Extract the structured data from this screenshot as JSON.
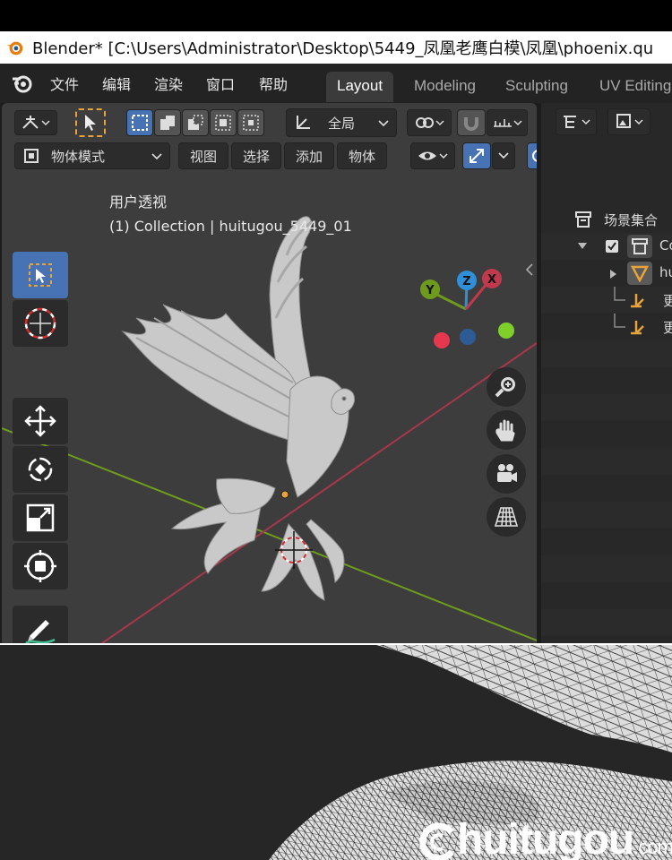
{
  "window": {
    "title": "Blender* [C:\\Users\\Administrator\\Desktop\\5449_凤凰老鹰白模\\凤凰\\phoenix.qu"
  },
  "menubar": {
    "items": [
      "文件",
      "编辑",
      "渲染",
      "窗口",
      "帮助"
    ],
    "workspaces": [
      "Layout",
      "Modeling",
      "Sculpting",
      "UV Editing"
    ],
    "active_workspace": "Layout"
  },
  "viewport_header": {
    "orientation_label": "全局",
    "mode_label": "物体模式",
    "menus": [
      "视图",
      "选择",
      "添加",
      "物体"
    ]
  },
  "viewport": {
    "view_name": "用户透视",
    "collection_info": "(1) Collection | huitugou_5449_01",
    "gizmo_axes": [
      "Y",
      "Z",
      "X"
    ]
  },
  "toolbar": {
    "tools": [
      "select-box",
      "cursor",
      "move",
      "rotate",
      "scale",
      "transform",
      "annotate",
      "measure"
    ]
  },
  "outliner": {
    "header": "场景集合",
    "items": [
      {
        "label": "Co",
        "type": "collection"
      },
      {
        "label": "hu",
        "type": "mesh"
      },
      {
        "label": "更",
        "type": "empty"
      },
      {
        "label": "更",
        "type": "empty"
      }
    ]
  },
  "lower_panel": {
    "watermark": "huitugou",
    "watermark_suffix": ".com"
  },
  "colors": {
    "accent_blue": "#4772b3",
    "axis_x": "#c0394d",
    "axis_y": "#6f9b1d",
    "axis_z": "#2f8fd8",
    "selection_orange": "#e8a33a"
  }
}
